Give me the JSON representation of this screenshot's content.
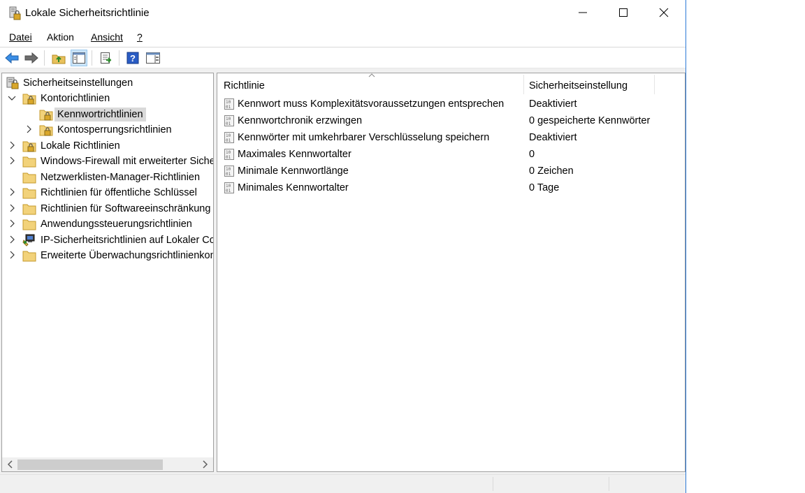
{
  "window": {
    "title": "Lokale Sicherheitsrichtlinie",
    "accent": "#2b79d7"
  },
  "menu": [
    {
      "label": "Datei",
      "mnemonic_index": 0
    },
    {
      "label": "Aktion",
      "mnemonic_index": 1
    },
    {
      "label": "Ansicht",
      "mnemonic_index": 0
    },
    {
      "label": "?",
      "mnemonic_index": 0
    }
  ],
  "toolbar": {
    "buttons": [
      "back-arrow-icon",
      "forward-arrow-icon",
      "up-folder-icon",
      "show-hide-tree-icon",
      "export-list-icon",
      "help-icon",
      "properties-icon"
    ]
  },
  "tree": {
    "root": "Sicherheitseinstellungen",
    "kontorichtlinien": "Kontorichtlinien",
    "kennwortrichtlinien": "Kennwortrichtlinien",
    "kontosperrungsrichtlinien": "Kontosperrungsrichtlinien",
    "lokale": "Lokale Richtlinien",
    "firewall": "Windows-Firewall mit erweiterter Sicherheit",
    "netzwerk": "Netzwerklisten-Manager-Richtlinien",
    "public_key": "Richtlinien für öffentliche Schlüssel",
    "software": "Richtlinien für Softwareeinschränkung",
    "anwendung": "Anwendungssteuerungsrichtlinien",
    "ipsec": "IP-Sicherheitsrichtlinien auf Lokaler Computer",
    "audit": "Erweiterte Überwachungsrichtlinienkonfiguration"
  },
  "list": {
    "col_policy": "Richtlinie",
    "col_setting": "Sicherheitseinstellung",
    "rows": [
      {
        "name": "Kennwort muss Komplexitätsvoraussetzungen entsprechen",
        "value": "Deaktiviert"
      },
      {
        "name": "Kennwortchronik erzwingen",
        "value": "0 gespeicherte Kennwörter"
      },
      {
        "name": "Kennwörter mit umkehrbarer Verschlüsselung speichern",
        "value": "Deaktiviert"
      },
      {
        "name": "Maximales Kennwortalter",
        "value": "0"
      },
      {
        "name": "Minimale Kennwortlänge",
        "value": "0 Zeichen"
      },
      {
        "name": "Minimales Kennwortalter",
        "value": "0 Tage"
      }
    ]
  }
}
